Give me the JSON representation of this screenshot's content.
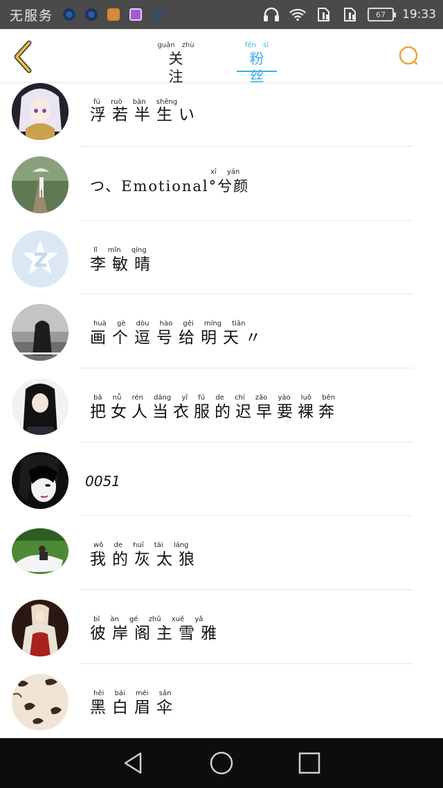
{
  "status_bar": {
    "carrier": "无服务",
    "time": "19:33",
    "battery": "67",
    "icons": [
      "headphones-icon",
      "wifi-icon",
      "sim-no-signal-icon",
      "sim-no-signal-icon"
    ]
  },
  "header": {
    "tabs": [
      {
        "label": "关注",
        "pinyin": [
          "guān",
          "zhù"
        ],
        "active": false
      },
      {
        "label": "粉丝",
        "pinyin": [
          "fěn",
          "sī"
        ],
        "active": true
      }
    ],
    "accent": "#3bb0ea",
    "icon_color": "#f5a033"
  },
  "fans": [
    {
      "name": "浮若半生い",
      "pinyin": "fú ruò bàn shēng"
    },
    {
      "name": "つ、Emotional°兮颜",
      "pinyin": "xī yán"
    },
    {
      "name": "李敏晴",
      "pinyin": "lǐ mǐn qíng"
    },
    {
      "name": "画个逗号给明天〃",
      "pinyin": "huà gè dòu hào gěi míng tiān"
    },
    {
      "name": "把女人当衣服的迟早要裸奔",
      "pinyin": "bǎ nǚ rén dāng yī fú de chí zǎo yào luǒ bēn"
    },
    {
      "name": "0051",
      "pinyin": ""
    },
    {
      "name": "我的灰太狼",
      "pinyin": "wǒ de huī tài láng"
    },
    {
      "name": "彼岸阁主雪雅",
      "pinyin": "bǐ àn gé zhǔ xuě yǎ"
    },
    {
      "name": "黑白眉伞",
      "pinyin": "hēi bái méi sǎn"
    }
  ]
}
